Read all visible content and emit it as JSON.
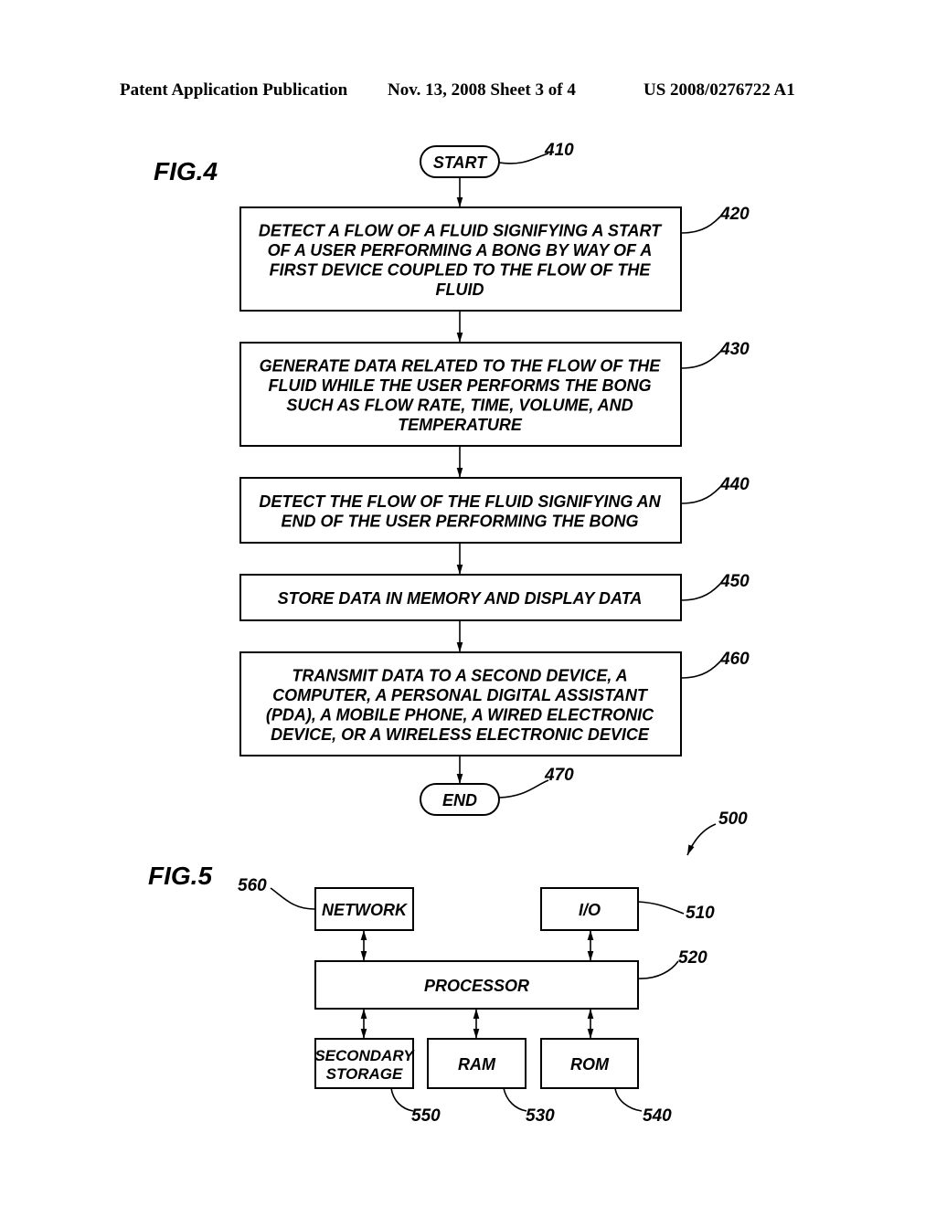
{
  "header": {
    "publication": "Patent Application Publication",
    "date_sheet": "Nov. 13, 2008   Sheet 3 of 4",
    "number": "US 2008/0276722 A1"
  },
  "fig4": {
    "label": "FIG.4",
    "start": {
      "text": "START",
      "ref": "410"
    },
    "steps": [
      {
        "ref": "420",
        "lines": [
          "DETECT A FLOW OF A FLUID SIGNIFYING A START",
          "OF A USER PERFORMING A BONG BY WAY OF A",
          "FIRST DEVICE COUPLED TO THE FLOW OF THE",
          "FLUID"
        ]
      },
      {
        "ref": "430",
        "lines": [
          "GENERATE DATA RELATED TO THE FLOW OF THE",
          "FLUID WHILE THE USER PERFORMS THE BONG",
          "SUCH AS FLOW RATE, TIME, VOLUME, AND",
          "TEMPERATURE"
        ]
      },
      {
        "ref": "440",
        "lines": [
          "DETECT THE FLOW OF THE FLUID SIGNIFYING AN",
          "END OF THE USER PERFORMING THE BONG"
        ]
      },
      {
        "ref": "450",
        "lines": [
          "STORE DATA IN MEMORY AND DISPLAY DATA"
        ]
      },
      {
        "ref": "460",
        "lines": [
          "TRANSMIT DATA TO A SECOND DEVICE, A",
          "COMPUTER, A PERSONAL DIGITAL ASSISTANT",
          "(PDA), A MOBILE PHONE, A WIRED ELECTRONIC",
          "DEVICE, OR A WIRELESS ELECTRONIC DEVICE"
        ]
      }
    ],
    "end": {
      "text": "END",
      "ref": "470"
    }
  },
  "fig5": {
    "label": "FIG.5",
    "ref": "500",
    "network": {
      "lines": [
        "NETWORK"
      ],
      "ref": "560"
    },
    "io": {
      "lines": [
        "I/O"
      ],
      "ref": "510"
    },
    "processor": {
      "lines": [
        "PROCESSOR"
      ],
      "ref": "520"
    },
    "secondary": {
      "lines": [
        "SECONDARY",
        "STORAGE"
      ],
      "ref": "550"
    },
    "ram": {
      "lines": [
        "RAM"
      ],
      "ref": "530"
    },
    "rom": {
      "lines": [
        "ROM"
      ],
      "ref": "540"
    }
  }
}
